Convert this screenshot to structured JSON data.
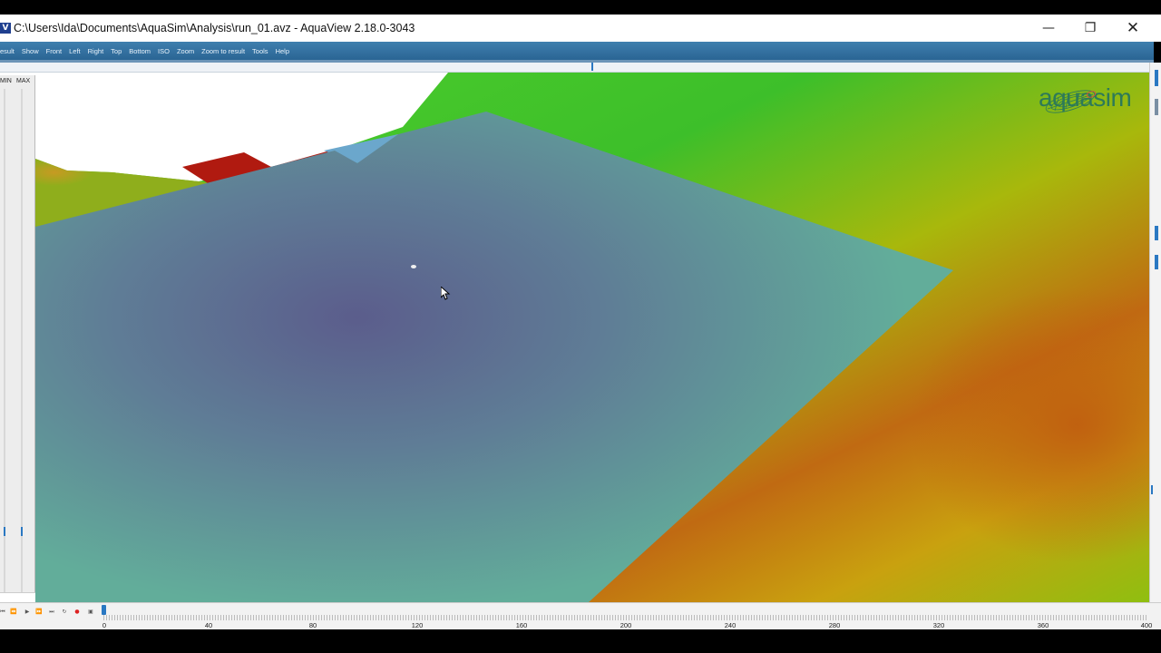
{
  "window": {
    "title": "C:\\Users\\Ida\\Documents\\AquaSim\\Analysis\\run_01.avz - AquaView 2.18.0-3043",
    "app_icon": "app-logo-icon",
    "controls": [
      "minimize-icon",
      "restore-icon",
      "close-icon"
    ]
  },
  "menu": {
    "items": [
      "esult",
      "Show",
      "Front",
      "Left",
      "Right",
      "Top",
      "Bottom",
      "ISO",
      "Zoom",
      "Zoom to result",
      "Tools",
      "Help"
    ]
  },
  "left_panel": {
    "min_label": "MIN",
    "max_label": "MAX"
  },
  "viewport": {
    "logo_text": "aquasim",
    "colors": {
      "surface_teal": "#5fa39a",
      "surface_purple": "#5b5f8e",
      "terrain_green": "#3dbf2a",
      "terrain_orange": "#c06a12",
      "terrain_yellow": "#a8b80c",
      "red_block": "#b01a10",
      "light_blue": "#6ba7cc"
    }
  },
  "timeline": {
    "ticks": [
      "0",
      "40",
      "80",
      "120",
      "160",
      "200",
      "240",
      "280",
      "320",
      "360",
      "400"
    ],
    "controls": [
      "skip-start-icon",
      "step-back-icon",
      "play-icon",
      "step-forward-icon",
      "skip-end-icon",
      "loop-icon",
      "record-icon",
      "camera-icon"
    ],
    "position": 0
  }
}
